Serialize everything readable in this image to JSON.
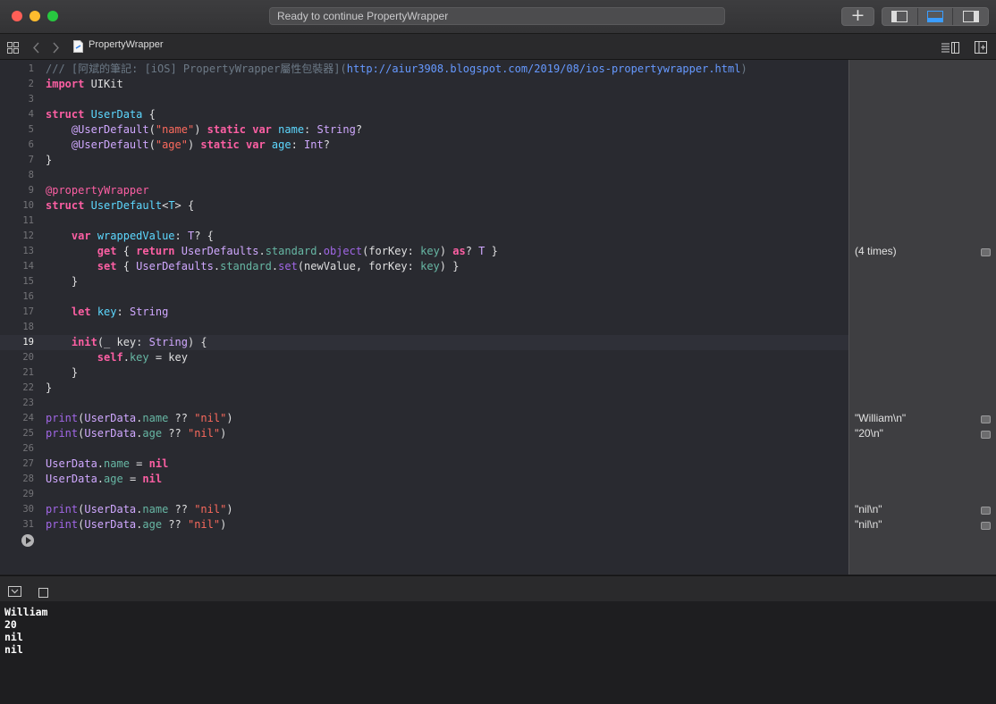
{
  "window": {
    "status_text": "Ready to continue PropertyWrapper",
    "add_button_label": "+"
  },
  "jumpbar": {
    "file_name": "PropertyWrapper"
  },
  "editor": {
    "lines": [
      {
        "n": "1",
        "code": "/// [阿斌的筆記: [iOS] PropertyWrapper屬性包裝器](http://aiur3908.blogspot.com/2019/08/ios-propertywrapper.html)"
      },
      {
        "n": "2",
        "code": "import UIKit"
      },
      {
        "n": "3",
        "code": ""
      },
      {
        "n": "4",
        "code": "struct UserData {"
      },
      {
        "n": "5",
        "code": "    @UserDefault(\"name\") static var name: String?"
      },
      {
        "n": "6",
        "code": "    @UserDefault(\"age\") static var age: Int?"
      },
      {
        "n": "7",
        "code": "}"
      },
      {
        "n": "8",
        "code": ""
      },
      {
        "n": "9",
        "code": "@propertyWrapper"
      },
      {
        "n": "10",
        "code": "struct UserDefault<T> {"
      },
      {
        "n": "11",
        "code": ""
      },
      {
        "n": "12",
        "code": "    var wrappedValue: T? {"
      },
      {
        "n": "13",
        "code": "        get { return UserDefaults.standard.object(forKey: key) as? T }"
      },
      {
        "n": "14",
        "code": "        set { UserDefaults.standard.set(newValue, forKey: key) }"
      },
      {
        "n": "15",
        "code": "    }"
      },
      {
        "n": "16",
        "code": ""
      },
      {
        "n": "17",
        "code": "    let key: String"
      },
      {
        "n": "18",
        "code": ""
      },
      {
        "n": "19",
        "code": "    init(_ key: String) {"
      },
      {
        "n": "20",
        "code": "        self.key = key"
      },
      {
        "n": "21",
        "code": "    }"
      },
      {
        "n": "22",
        "code": "}"
      },
      {
        "n": "23",
        "code": ""
      },
      {
        "n": "24",
        "code": "print(UserData.name ?? \"nil\")"
      },
      {
        "n": "25",
        "code": "print(UserData.age ?? \"nil\")"
      },
      {
        "n": "26",
        "code": ""
      },
      {
        "n": "27",
        "code": "UserData.name = nil"
      },
      {
        "n": "28",
        "code": "UserData.age = nil"
      },
      {
        "n": "29",
        "code": ""
      },
      {
        "n": "30",
        "code": "print(UserData.name ?? \"nil\")"
      },
      {
        "n": "31",
        "code": "print(UserData.age ?? \"nil\")"
      }
    ],
    "current_line": "19"
  },
  "results": [
    {
      "line": "13",
      "text": "(4 times)"
    },
    {
      "line": "24",
      "text": "\"William\\n\""
    },
    {
      "line": "25",
      "text": "\"20\\n\""
    },
    {
      "line": "30",
      "text": "\"nil\\n\""
    },
    {
      "line": "31",
      "text": "\"nil\\n\""
    }
  ],
  "console": {
    "output": [
      "William",
      "20",
      "nil",
      "nil"
    ]
  },
  "colors": {
    "keyword": "#fc5fa3",
    "string": "#fc6a5d",
    "type": "#d0a8ff",
    "comment": "#6c7986",
    "link": "#6699ff",
    "property": "#67b7a4",
    "function": "#a167e6"
  },
  "icons": [
    "grid-icon",
    "back-arrow-icon",
    "forward-arrow-icon",
    "swift-file-icon",
    "navigator-panel-icon",
    "debug-panel-icon",
    "inspector-panel-icon",
    "editor-options-icon",
    "add-editor-icon",
    "hide-debug-area-icon",
    "console-toggle-icon",
    "run-button-icon",
    "quick-look-icon"
  ]
}
